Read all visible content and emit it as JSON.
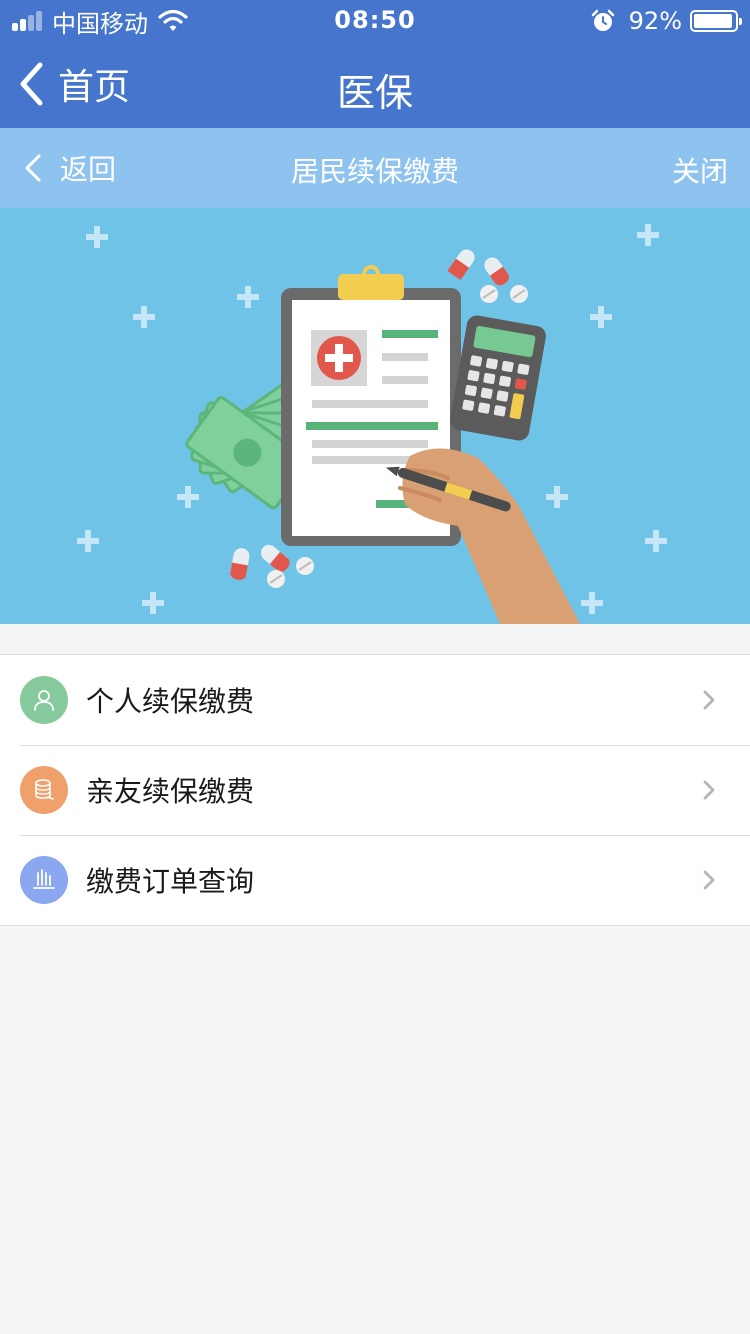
{
  "status_bar": {
    "carrier": "中国移动",
    "time": "08:50",
    "battery_percent": "92%",
    "battery_level": 0.92,
    "icons": [
      "signal-icon",
      "wifi-icon",
      "alarm-icon",
      "battery-icon"
    ]
  },
  "nav": {
    "back_label": "首页",
    "title": "医保"
  },
  "sub_header": {
    "back_label": "返回",
    "title": "居民续保缴费",
    "close_label": "关闭"
  },
  "banner": {
    "illustration": "medical-insurance-payment-illustration",
    "background_color": "#6ec3e6"
  },
  "menu": {
    "items": [
      {
        "label": "个人续保缴费",
        "icon": "person-icon",
        "icon_color": "#86c99c"
      },
      {
        "label": "亲友续保缴费",
        "icon": "coins-icon",
        "icon_color": "#f0a06b"
      },
      {
        "label": "缴费订单查询",
        "icon": "chart-bars-icon",
        "icon_color": "#8aa7ef"
      }
    ]
  },
  "colors": {
    "nav_blue": "#4575cc",
    "sub_header_blue": "#8ec3f0",
    "page_background": "#f5f5f5"
  }
}
